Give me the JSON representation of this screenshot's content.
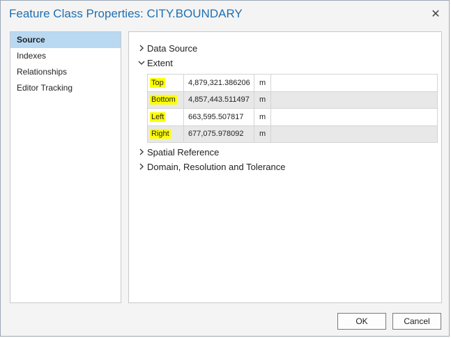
{
  "window": {
    "title": "Feature Class Properties: CITY.BOUNDARY",
    "close_icon": "close-icon"
  },
  "sidebar": {
    "items": [
      {
        "label": "Source",
        "selected": true
      },
      {
        "label": "Indexes",
        "selected": false
      },
      {
        "label": "Relationships",
        "selected": false
      },
      {
        "label": "Editor Tracking",
        "selected": false
      }
    ]
  },
  "sections": {
    "data_source": {
      "label": "Data Source",
      "expanded": false
    },
    "extent": {
      "label": "Extent",
      "expanded": true
    },
    "spatial_reference": {
      "label": "Spatial Reference",
      "expanded": false
    },
    "domain": {
      "label": "Domain, Resolution and Tolerance",
      "expanded": false
    }
  },
  "extent": {
    "rows": [
      {
        "label": "Top",
        "value": "4,879,321.386206",
        "unit": "m"
      },
      {
        "label": "Bottom",
        "value": "4,857,443.511497",
        "unit": "m"
      },
      {
        "label": "Left",
        "value": "663,595.507817",
        "unit": "m"
      },
      {
        "label": "Right",
        "value": "677,075.978092",
        "unit": "m"
      }
    ]
  },
  "buttons": {
    "ok_label": "OK",
    "cancel_label": "Cancel"
  },
  "colors": {
    "title": "#1f6fb2",
    "selected_nav": "#b9d9f2",
    "highlight": "#ffff00"
  }
}
